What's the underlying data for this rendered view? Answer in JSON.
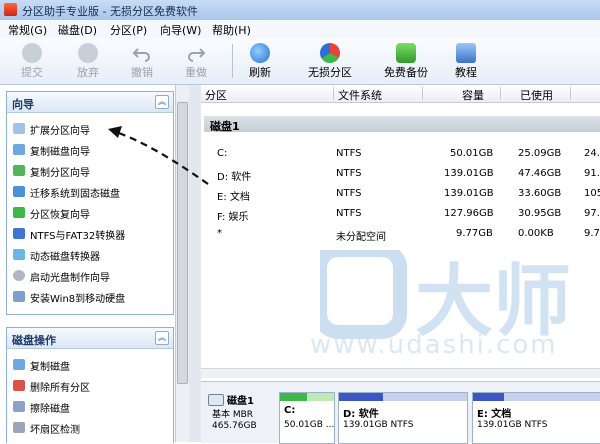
{
  "window": {
    "title": "分区助手专业版 - 无损分区免费软件"
  },
  "menu": [
    {
      "label": "常规(G)"
    },
    {
      "label": "磁盘(D)"
    },
    {
      "label": "分区(P)"
    },
    {
      "label": "向导(W)"
    },
    {
      "label": "帮助(H)"
    }
  ],
  "toolbar": {
    "submit": "提交",
    "discard": "放弃",
    "undo": "撤销",
    "redo": "重做",
    "refresh": "刷新",
    "lossless": "无损分区",
    "backup": "免费备份",
    "tutorial": "教程"
  },
  "wizard_panel": {
    "title": "向导",
    "items": [
      {
        "label": "扩展分区向导"
      },
      {
        "label": "复制磁盘向导"
      },
      {
        "label": "复制分区向导"
      },
      {
        "label": "迁移系统到固态磁盘"
      },
      {
        "label": "分区恢复向导"
      },
      {
        "label": "NTFS与FAT32转换器"
      },
      {
        "label": "动态磁盘转换器"
      },
      {
        "label": "启动光盘制作向导"
      },
      {
        "label": "安装Win8到移动硬盘"
      }
    ]
  },
  "disk_ops_panel": {
    "title": "磁盘操作",
    "items": [
      {
        "label": "复制磁盘"
      },
      {
        "label": "删除所有分区"
      },
      {
        "label": "擦除磁盘"
      },
      {
        "label": "坏扇区检测"
      }
    ]
  },
  "table": {
    "columns": [
      "分区",
      "文件系统",
      "容量",
      "已使用"
    ],
    "disk_label": "磁盘1",
    "rows": [
      {
        "name": "C:",
        "fs": "NTFS",
        "size": "50.01GB",
        "used": "25.09GB",
        "extra": "24."
      },
      {
        "name": "D: 软件",
        "fs": "NTFS",
        "size": "139.01GB",
        "used": "47.46GB",
        "extra": "91."
      },
      {
        "name": "E: 文档",
        "fs": "NTFS",
        "size": "139.01GB",
        "used": "33.60GB",
        "extra": "105"
      },
      {
        "name": "F: 娱乐",
        "fs": "NTFS",
        "size": "127.96GB",
        "used": "30.95GB",
        "extra": "97."
      },
      {
        "name": "*",
        "fs": "未分配空间",
        "size": "9.77GB",
        "used": "0.00KB",
        "extra": "9.7"
      }
    ]
  },
  "diskmap": {
    "disk": {
      "name": "磁盘1",
      "type": "基本 MBR",
      "size": "465.76GB"
    },
    "partitions": [
      {
        "name": "C:",
        "info": "50.01GB ...",
        "fill_color": "#3fb84a"
      },
      {
        "name": "D: 软件",
        "info": "139.01GB NTFS",
        "fill_color": "#3d56c4"
      },
      {
        "name": "E: 文档",
        "info": "139.01GB NTFS",
        "fill_color": "#3d56c4"
      }
    ]
  },
  "watermark": {
    "logo_text": "U大师",
    "url": "www.udashi.com"
  },
  "colors": {
    "accent": "#2b6fd6",
    "used": "#3fb84a",
    "ntfs": "#3d56c4"
  }
}
